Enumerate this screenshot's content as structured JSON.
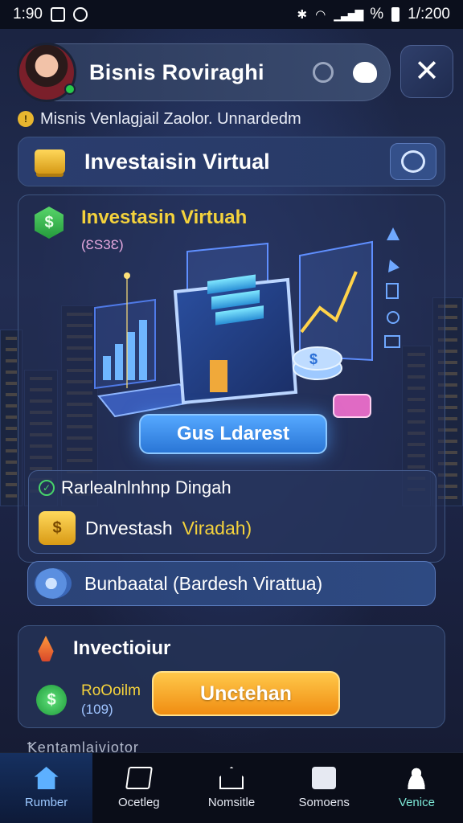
{
  "status_bar": {
    "time": "1:90",
    "right_text": "1/:200",
    "battery_text": "%"
  },
  "header": {
    "user_name": "Bisnis Roviraghi"
  },
  "ticker": {
    "text": "Misnis Venlagjail Zaolor. Unnardedm"
  },
  "section_title": {
    "label": "Investaisin Virtual"
  },
  "hero": {
    "title": "Investasin Virtuah",
    "subtitle": "(ƐS3Ɛ)",
    "cta_label": "Gus Ldarest",
    "sub_panel": {
      "title": "Rarlealnlnhnp Dingah",
      "item_main": "Dnvestash",
      "item_accent": "Viradah)"
    }
  },
  "row_card": {
    "label": "Bunbaatal (Bardesh Virattua)"
  },
  "invest_card": {
    "title": "Invectioiur",
    "left_title": "RoOoilm",
    "left_sub": "(109)",
    "button_label": "Unctehan"
  },
  "peek_text": "Ꝁentamlaiviotor",
  "nav": [
    {
      "label": "Rumber",
      "icon": "home-icon"
    },
    {
      "label": "Ocetleg",
      "icon": "category-icon"
    },
    {
      "label": "Nomsitle",
      "icon": "house-outline-icon"
    },
    {
      "label": "Somoens",
      "icon": "box-icon"
    },
    {
      "label": "Venice",
      "icon": "user-icon"
    }
  ],
  "colors": {
    "accent_gold": "#f4d23c",
    "cta_blue": "#2a76d6",
    "cta_orange": "#f08d12",
    "nav_active": "#5db0ff"
  }
}
